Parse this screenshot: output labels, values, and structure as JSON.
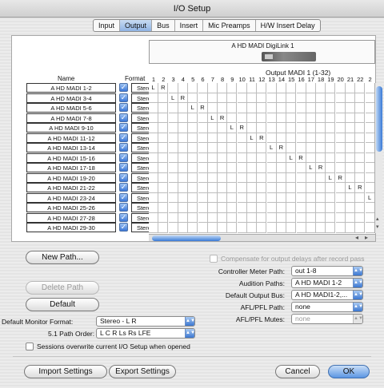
{
  "window": {
    "title": "I/O Setup"
  },
  "tabs": [
    "Input",
    "Output",
    "Bus",
    "Insert",
    "Mic Preamps",
    "H/W Insert Delay"
  ],
  "active_tab": "Output",
  "device": {
    "name": "A HD MADI DigiLink 1",
    "output_label": "Output MADI 1 (1-32)"
  },
  "columns": {
    "name": "Name",
    "format": "Format",
    "numbers": [
      "1",
      "2",
      "3",
      "4",
      "5",
      "6",
      "7",
      "8",
      "9",
      "10",
      "11",
      "12",
      "13",
      "14",
      "15",
      "16",
      "17",
      "18",
      "19",
      "20",
      "21",
      "22",
      "2"
    ]
  },
  "rows": [
    {
      "name": "A HD MADI 1-2",
      "format": "Stereo"
    },
    {
      "name": "A HD MADI 3-4",
      "format": "Stereo"
    },
    {
      "name": "A HD MADI 5-6",
      "format": "Stereo"
    },
    {
      "name": "A HD MADI 7-8",
      "format": "Stereo"
    },
    {
      "name": "A HD MADI 9-10",
      "format": "Stereo"
    },
    {
      "name": "A HD MADI 11-12",
      "format": "Stereo"
    },
    {
      "name": "A HD MADI 13-14",
      "format": "Stereo"
    },
    {
      "name": "A HD MADI 15-16",
      "format": "Stereo"
    },
    {
      "name": "A HD MADI 17-18",
      "format": "Stereo"
    },
    {
      "name": "A HD MADI 19-20",
      "format": "Stereo"
    },
    {
      "name": "A HD MADI 21-22",
      "format": "Stereo"
    },
    {
      "name": "A HD MADI 23-24",
      "format": "Stereo"
    },
    {
      "name": "A HD MADI 25-26",
      "format": "Stereo"
    },
    {
      "name": "A HD MADI 27-28",
      "format": "Stereo"
    },
    {
      "name": "A HD MADI 29-30",
      "format": "Stereo"
    }
  ],
  "grid_letters": {
    "left": "L",
    "right": "R"
  },
  "buttons": {
    "new_path": "New Path...",
    "delete_path": "Delete Path",
    "default": "Default",
    "import": "Import Settings",
    "export": "Export Settings",
    "cancel": "Cancel",
    "ok": "OK"
  },
  "left_settings": {
    "monitor_format_label": "Default Monitor Format:",
    "monitor_format_value": "Stereo - L R",
    "path_order_label": "5.1 Path Order:",
    "path_order_value": "L C R Ls Rs LFE",
    "overwrite_label": "Sessions overwrite current I/O Setup when opened"
  },
  "right_settings": {
    "compensate_label": "Compensate for output delays after record pass",
    "controller_meter_label": "Controller Meter Path:",
    "controller_meter_value": "out 1-8",
    "audition_label": "Audition Paths:",
    "audition_value": "A HD MADI 1-2",
    "default_output_label": "Default Output Bus:",
    "default_output_value": "A HD MADI1-2,...",
    "afl_path_label": "AFL/PFL Path:",
    "afl_path_value": "none",
    "afl_mutes_label": "AFL/PFL Mutes:",
    "afl_mutes_value": "none"
  },
  "icons": {
    "check": "✓",
    "select_arrows": "▲▼",
    "scroll_left": "◂",
    "scroll_right": "▸",
    "scroll_up": "▴",
    "scroll_down": "▾"
  }
}
